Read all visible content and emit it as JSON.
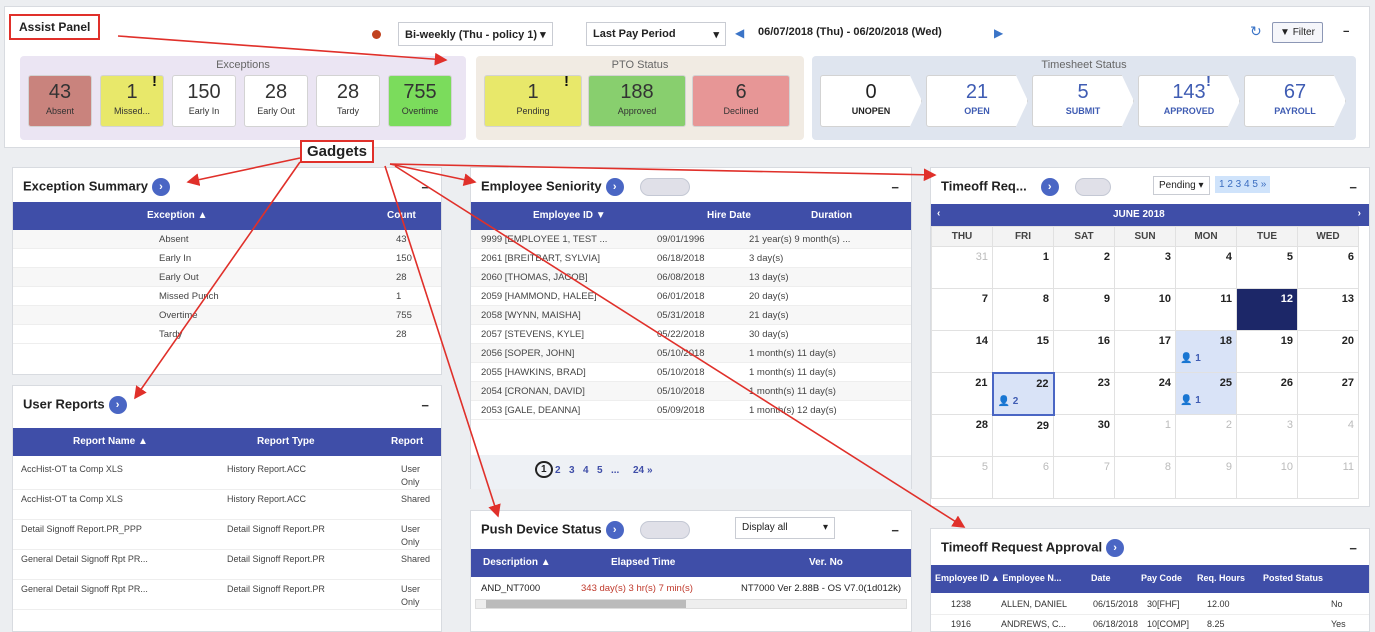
{
  "assist": {
    "title": "Assist Panel",
    "gadgets_label": "Gadgets"
  },
  "filters": {
    "policy": "Bi-weekly (Thu - policy 1)",
    "period": "Last Pay Period",
    "range": "06/07/2018 (Thu) - 06/20/2018 (Wed)",
    "filter": "Filter",
    "refresh_icon": "refresh-icon"
  },
  "exceptions": {
    "title": "Exceptions",
    "tiles": [
      {
        "value": "43",
        "label": "Absent",
        "color": "#c9837d"
      },
      {
        "value": "1",
        "label": "Missed...",
        "color": "#e8e86a",
        "badge": "!"
      },
      {
        "value": "150",
        "label": "Early In",
        "color": "#ffffff"
      },
      {
        "value": "28",
        "label": "Early Out",
        "color": "#ffffff"
      },
      {
        "value": "28",
        "label": "Tardy",
        "color": "#ffffff"
      },
      {
        "value": "755",
        "label": "Overtime",
        "color": "#7bdc5c"
      }
    ]
  },
  "pto": {
    "title": "PTO Status",
    "tiles": [
      {
        "value": "1",
        "label": "Pending",
        "color": "#e8e86a",
        "badge": "!"
      },
      {
        "value": "188",
        "label": "Approved",
        "color": "#88cf6e"
      },
      {
        "value": "6",
        "label": "Declined",
        "color": "#e79696"
      }
    ]
  },
  "timesheet": {
    "title": "Timesheet Status",
    "steps": [
      {
        "value": "0",
        "label": "UNOPEN"
      },
      {
        "value": "21",
        "label": "OPEN"
      },
      {
        "value": "5",
        "label": "SUBMIT"
      },
      {
        "value": "143",
        "label": "APPROVED",
        "badge": "!"
      },
      {
        "value": "67",
        "label": "PAYROLL"
      }
    ]
  },
  "exc_summary": {
    "title": "Exception Summary",
    "headers": [
      "Exception ▲",
      "Count"
    ],
    "rows": [
      [
        "Absent",
        "43"
      ],
      [
        "Early In",
        "150"
      ],
      [
        "Early Out",
        "28"
      ],
      [
        "Missed Punch",
        "1"
      ],
      [
        "Overtime",
        "755"
      ],
      [
        "Tardy",
        "28"
      ]
    ]
  },
  "user_reports": {
    "title": "User Reports",
    "headers": [
      "Report Name ▲",
      "Report Type",
      "Report"
    ],
    "rows": [
      [
        "AccHist-OT ta Comp XLS",
        "History Report.ACC",
        "User",
        "Only"
      ],
      [
        "AccHist-OT ta Comp XLS",
        "History Report.ACC",
        "Shared",
        ""
      ],
      [
        "Detail Signoff Report.PR_PPP",
        "Detail Signoff Report.PR",
        "User",
        "Only"
      ],
      [
        "General Detail Signoff Rpt PR...",
        "Detail Signoff Report.PR",
        "Shared",
        ""
      ],
      [
        "General Detail Signoff Rpt PR...",
        "Detail Signoff Report.PR",
        "User",
        "Only"
      ]
    ]
  },
  "seniority": {
    "title": "Employee Seniority",
    "headers": [
      "Employee ID ▼",
      "Hire Date",
      "Duration"
    ],
    "rows": [
      [
        "9999 [EMPLOYEE 1, TEST ...",
        "09/01/1996",
        "21 year(s) 9 month(s) ..."
      ],
      [
        "2061 [BREITBART, SYLVIA]",
        "06/18/2018",
        "3 day(s)"
      ],
      [
        "2060 [THOMAS, JACOB]",
        "06/08/2018",
        "13 day(s)"
      ],
      [
        "2059 [HAMMOND, HALEE]",
        "06/01/2018",
        "20 day(s)"
      ],
      [
        "2058 [WYNN, MAISHA]",
        "05/31/2018",
        "21 day(s)"
      ],
      [
        "2057 [STEVENS, KYLE]",
        "05/22/2018",
        "30 day(s)"
      ],
      [
        "2056 [SOPER, JOHN]",
        "05/10/2018",
        "1 month(s) 11 day(s)"
      ],
      [
        "2055 [HAWKINS, BRAD]",
        "05/10/2018",
        "1 month(s) 11 day(s)"
      ],
      [
        "2054 [CRONAN, DAVID]",
        "05/10/2018",
        "1 month(s) 11 day(s)"
      ],
      [
        "2053 [GALE, DEANNA]",
        "05/09/2018",
        "1 month(s) 12 day(s)"
      ]
    ],
    "pager": [
      "1",
      "2",
      "3",
      "4",
      "5",
      "...",
      "24",
      "»"
    ]
  },
  "push": {
    "title": "Push Device Status",
    "display": "Display all",
    "headers": [
      "Description ▲",
      "Elapsed Time",
      "Ver. No"
    ],
    "row": [
      "AND_NT7000",
      "343 day(s) 3 hr(s) 7 min(s)",
      "NT7000 Ver 2.88B - OS V7.0(1d012k)"
    ]
  },
  "timeoff": {
    "title": "Timeoff Req...",
    "status": "Pending",
    "pages": "1 2 3 4 5 »",
    "month": "JUNE 2018",
    "days": [
      "THU",
      "FRI",
      "SAT",
      "SUN",
      "MON",
      "TUE",
      "WED"
    ],
    "weeks": [
      [
        "31",
        "1",
        "2",
        "3",
        "4",
        "5",
        "6"
      ],
      [
        "7",
        "8",
        "9",
        "10",
        "11",
        "12",
        "13"
      ],
      [
        "14",
        "15",
        "16",
        "17",
        "18",
        "19",
        "20"
      ],
      [
        "21",
        "22",
        "23",
        "24",
        "25",
        "26",
        "27"
      ],
      [
        "28",
        "29",
        "30",
        "1",
        "2",
        "3",
        "4"
      ],
      [
        "5",
        "6",
        "7",
        "8",
        "9",
        "10",
        "11"
      ]
    ],
    "counts": {
      "18": "1",
      "22": "2",
      "25": "1"
    }
  },
  "approval": {
    "title": "Timeoff Request Approval",
    "headers": [
      "Employee ID",
      "▲ Employee N...",
      "Date",
      "Pay Code",
      "Req. Hours",
      "Posted Status"
    ],
    "rows": [
      [
        "1238",
        "ALLEN, DANIEL",
        "06/15/2018",
        "30[FHF]",
        "12.00",
        "No"
      ],
      [
        "1916",
        "ANDREWS, C...",
        "06/18/2018",
        "10[COMP]",
        "8.25",
        "Yes"
      ]
    ]
  }
}
